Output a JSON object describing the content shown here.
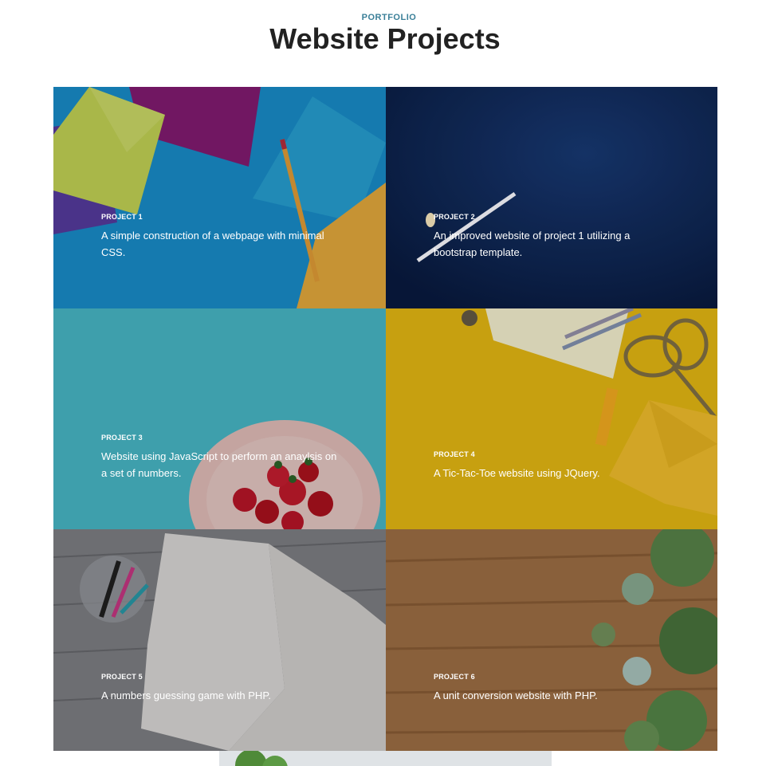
{
  "header": {
    "eyebrow": "PORTFOLIO",
    "title": "Website Projects"
  },
  "projects": [
    {
      "label": "PROJECT 1",
      "description": "A simple construction of a webpage with minimal CSS.",
      "bg": "#1a95d6"
    },
    {
      "label": "PROJECT 2",
      "description": "An improved website of project 1 utilizing a bootstrap template.",
      "bg": "#0c2349"
    },
    {
      "label": "PROJECT 3",
      "description": "Website using JavaScript to perform an anaylsis on a set of numbers.",
      "bg": "#4cc3d2"
    },
    {
      "label": "PROJECT 4",
      "description": "A Tic-Tac-Toe website using JQuery.",
      "bg": "#d8ae12"
    },
    {
      "label": "PROJECT 5",
      "description": "A numbers guessing game with PHP.",
      "bg": "#7c7c82"
    },
    {
      "label": "PROJECT 6",
      "description": "A unit conversion website with PHP.",
      "bg": "#9a6a43"
    }
  ]
}
